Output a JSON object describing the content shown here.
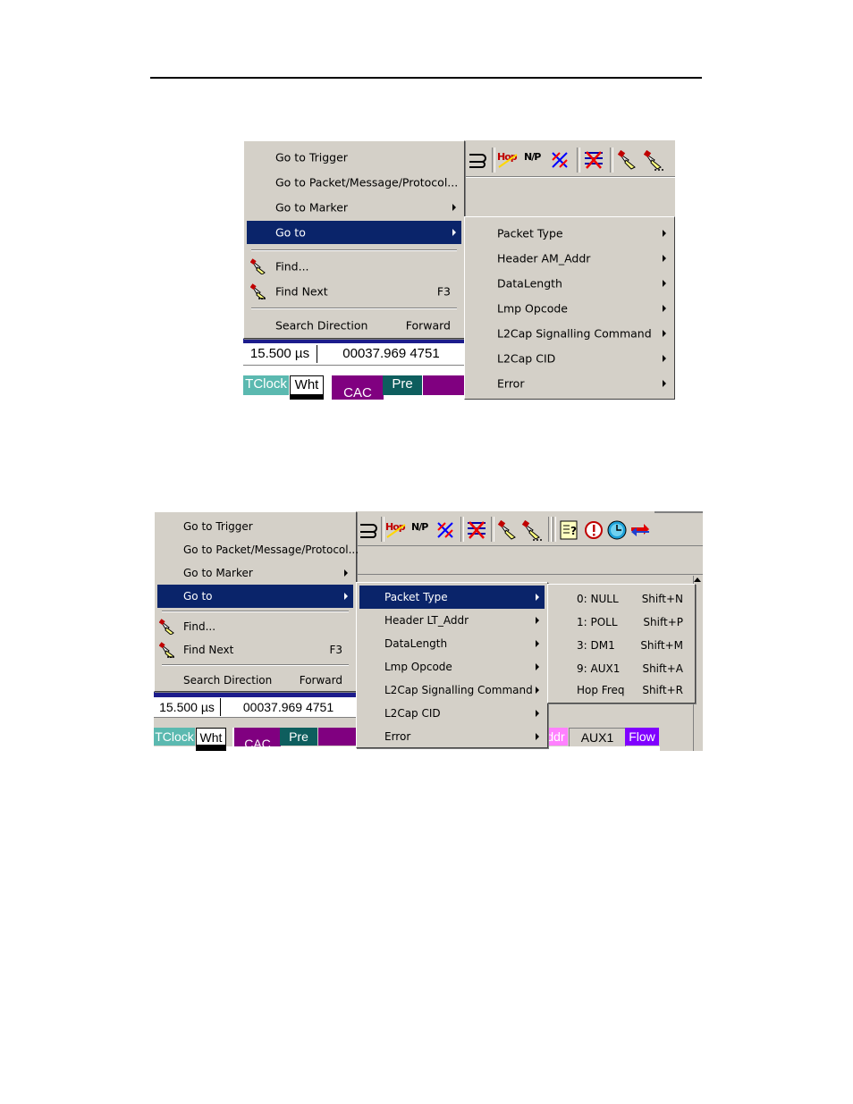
{
  "menu1": {
    "items": [
      {
        "label": "Go to Trigger"
      },
      {
        "label": "Go to Packet/Message/Protocol..."
      },
      {
        "label": "Go to Marker"
      },
      {
        "label": "Go to"
      },
      {
        "label": "Find..."
      },
      {
        "label": "Find Next",
        "shortcut": "F3"
      },
      {
        "label": "Search Direction",
        "value": "Forward"
      }
    ]
  },
  "submenu1": {
    "items": [
      "Packet Type",
      "Header AM_Addr",
      "DataLength",
      "Lmp Opcode",
      "L2Cap Signalling Command",
      "L2Cap CID",
      "Error"
    ]
  },
  "menu2": {
    "items": [
      {
        "label": "Go to Trigger"
      },
      {
        "label": "Go to Packet/Message/Protocol..."
      },
      {
        "label": "Go to Marker"
      },
      {
        "label": "Go to"
      },
      {
        "label": "Find..."
      },
      {
        "label": "Find Next",
        "shortcut": "F3"
      },
      {
        "label": "Search Direction",
        "value": "Forward"
      }
    ]
  },
  "submenu2": {
    "items": [
      "Packet Type",
      "Header LT_Addr",
      "DataLength",
      "Lmp Opcode",
      "L2Cap Signalling Command",
      "L2Cap CID",
      "Error"
    ]
  },
  "packettype": {
    "items": [
      {
        "label": "0: NULL",
        "shortcut": "Shift+N"
      },
      {
        "label": "1: POLL",
        "shortcut": "Shift+P"
      },
      {
        "label": "3: DM1",
        "shortcut": "Shift+M"
      },
      {
        "label": "9: AUX1",
        "shortcut": "Shift+A"
      },
      {
        "label": "Hop Freq",
        "shortcut": "Shift+R"
      }
    ]
  },
  "status": {
    "delta": "15.500 µs",
    "time": "00037.969 4751"
  },
  "fields1": {
    "tclock": "TClock",
    "wht": "Wht",
    "cac": "CAC",
    "pre": "Pre"
  },
  "fields2": {
    "tclock": "TClock",
    "wht": "Wht",
    "cac": "CAC",
    "pre": "Pre",
    "addr": "ddr",
    "aux1": "AUX1",
    "flow": "Flow"
  },
  "toolbar": {
    "hop": "Hop",
    "np": "N/P"
  },
  "colors": {
    "highlight": "#0a246a",
    "menu_bg": "#d4d0c8",
    "teal": "#5bb9b0",
    "purple": "#800080",
    "dark_teal": "#0e5e5e",
    "pink": "#ff80ff",
    "violet": "#8000ff"
  }
}
